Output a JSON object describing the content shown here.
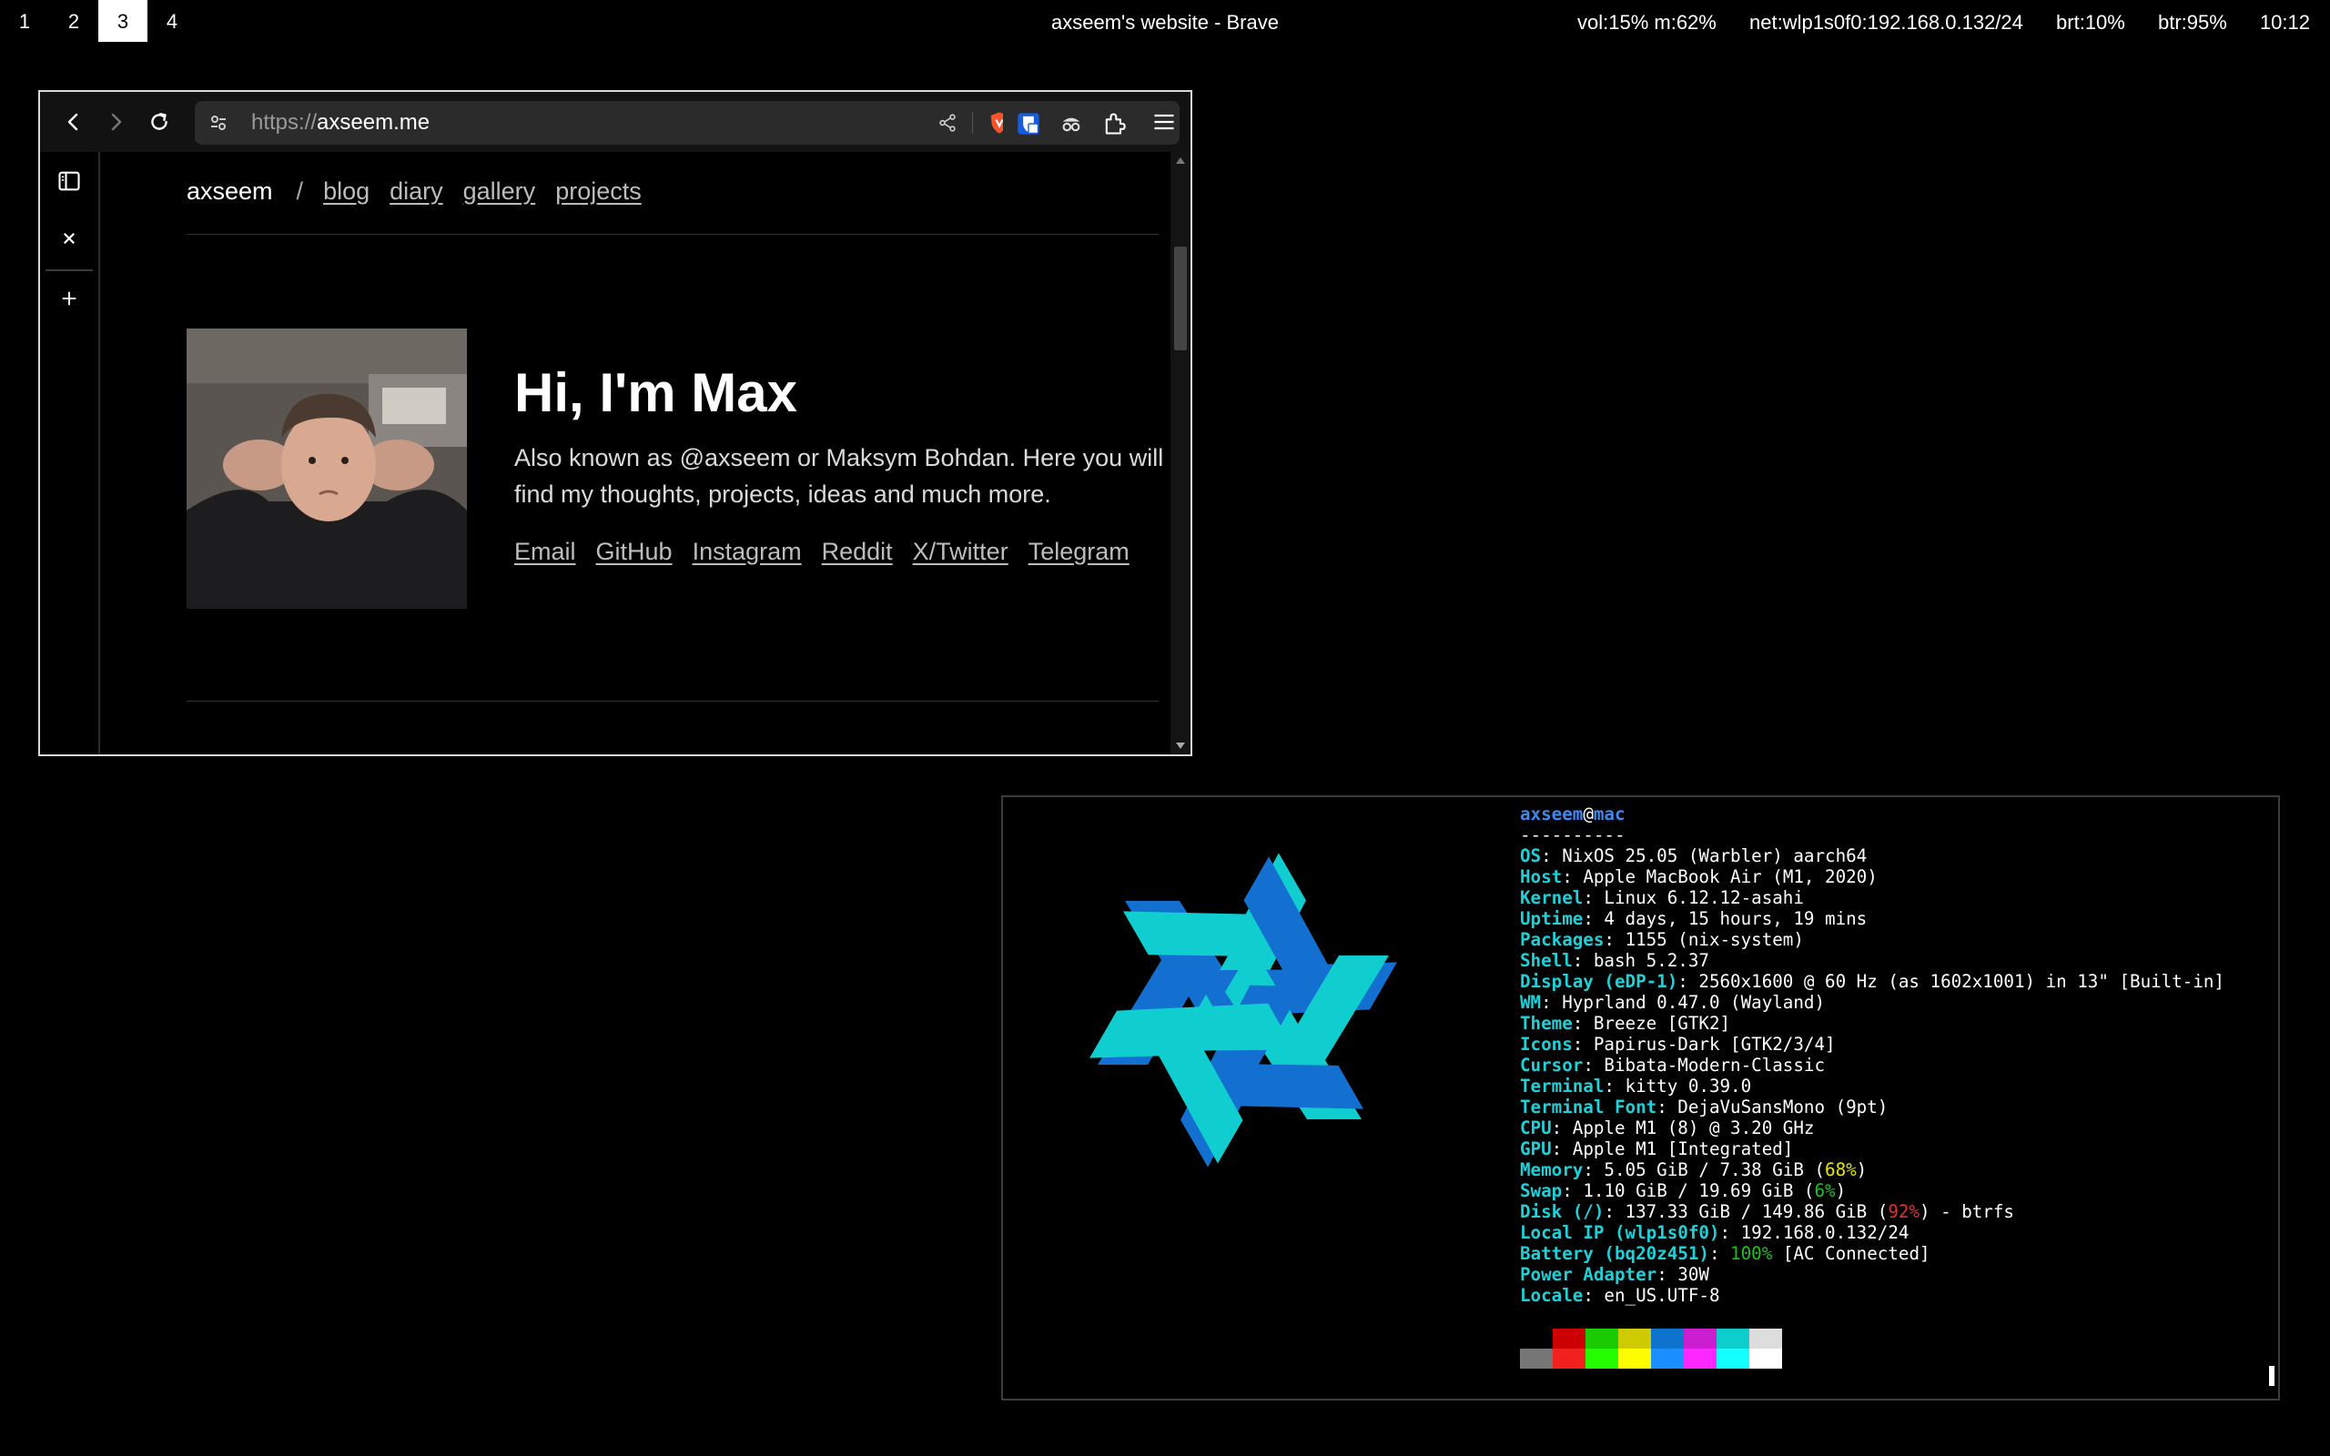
{
  "topbar": {
    "workspaces": [
      "1",
      "2",
      "3",
      "4"
    ],
    "active_workspace": "3",
    "window_title": "axseem's website - Brave",
    "status": {
      "volume": "vol:15% m:62%",
      "network": "net:wlp1s0f0:192.168.0.132/24",
      "brightness": "brt:10%",
      "battery": "btr:95%",
      "clock": "10:12"
    }
  },
  "browser": {
    "url_scheme": "https://",
    "url_host": "axseem.me",
    "nav": {
      "brand": "axseem",
      "separator": "/",
      "links": [
        "blog",
        "diary",
        "gallery",
        "projects"
      ]
    },
    "hero": {
      "title": "Hi, I'm Max",
      "subtitle": "Also known as @axseem or Maksym Bohdan. Here you will find my thoughts, projects, ideas and much more.",
      "links": [
        "Email",
        "GitHub",
        "Instagram",
        "Reddit",
        "X/Twitter",
        "Telegram"
      ]
    }
  },
  "terminal": {
    "user": "axseem",
    "at": "@",
    "host": "mac",
    "underline": "----------",
    "info": [
      {
        "key": "OS",
        "value": "NixOS 25.05 (Warbler) aarch64"
      },
      {
        "key": "Host",
        "value": "Apple MacBook Air (M1, 2020)"
      },
      {
        "key": "Kernel",
        "value": "Linux 6.12.12-asahi"
      },
      {
        "key": "Uptime",
        "value": "4 days, 15 hours, 19 mins"
      },
      {
        "key": "Packages",
        "value": "1155 (nix-system)"
      },
      {
        "key": "Shell",
        "value": "bash 5.2.37"
      },
      {
        "key": "Display (eDP-1)",
        "value": "2560x1600 @ 60 Hz (as 1602x1001) in 13\" [Built-in]"
      },
      {
        "key": "WM",
        "value": "Hyprland 0.47.0 (Wayland)"
      },
      {
        "key": "Theme",
        "value": "Breeze [GTK2]"
      },
      {
        "key": "Icons",
        "value": "Papirus-Dark [GTK2/3/4]"
      },
      {
        "key": "Cursor",
        "value": "Bibata-Modern-Classic"
      },
      {
        "key": "Terminal",
        "value": "kitty 0.39.0"
      },
      {
        "key": "Terminal Font",
        "value": "DejaVuSansMono (9pt)"
      },
      {
        "key": "CPU",
        "value": "Apple M1 (8) @ 3.20 GHz"
      },
      {
        "key": "GPU",
        "value": "Apple M1 [Integrated]"
      },
      {
        "key": "Memory",
        "value": "5.05 GiB / 7.38 GiB (",
        "hl": "68%",
        "hl_color": "#e8e800",
        "tail": ")"
      },
      {
        "key": "Swap",
        "value": "1.10 GiB / 19.69 GiB (",
        "hl": "6%",
        "hl_color": "#20c020",
        "tail": ")"
      },
      {
        "key": "Disk (/)",
        "value": "137.33 GiB / 149.86 GiB (",
        "hl": "92%",
        "hl_color": "#e03030",
        "tail": ") - btrfs"
      },
      {
        "key": "Local IP (wlp1s0f0)",
        "value": "192.168.0.132/24"
      },
      {
        "key": "Battery (bq20z451)",
        "value": "",
        "hl": "100%",
        "hl_color": "#20c020",
        "tail": " [AC Connected]"
      },
      {
        "key": "Power Adapter",
        "value": "30W"
      },
      {
        "key": "Locale",
        "value": "en_US.UTF-8"
      }
    ],
    "palette": {
      "dark": [
        "#000000",
        "#cc0000",
        "#19cb00",
        "#cecb00",
        "#0d73cc",
        "#cb1ed1",
        "#0dcdcd",
        "#dddddd"
      ],
      "bright": [
        "#767676",
        "#f2201f",
        "#23fd00",
        "#fffd00",
        "#1a8fff",
        "#fd28ff",
        "#14ffff",
        "#ffffff"
      ]
    },
    "logo_colors": {
      "dark": "#1470d0",
      "light": "#10cdd0"
    }
  }
}
